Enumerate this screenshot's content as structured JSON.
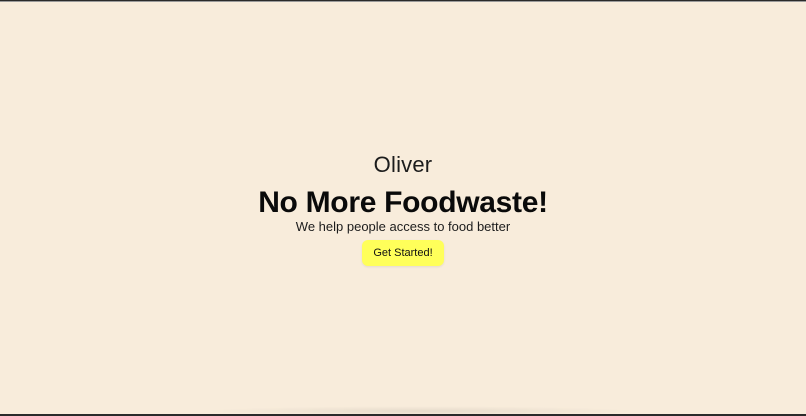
{
  "hero": {
    "brand": "Oliver",
    "headline": "No More Foodwaste!",
    "tagline": "We help people access to food better",
    "cta_label": "Get Started!"
  },
  "colors": {
    "background": "#f8ecdb",
    "cta_background": "#ffff5a",
    "text": "#0a0a0a"
  }
}
